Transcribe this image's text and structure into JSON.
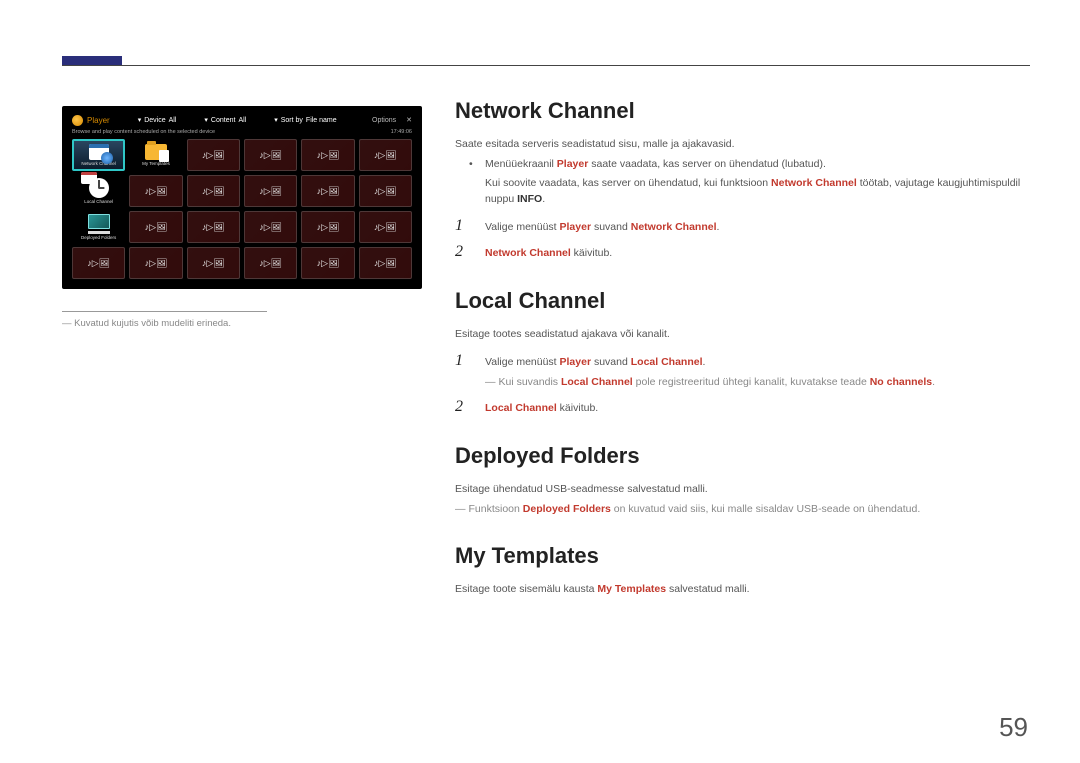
{
  "thumb": {
    "player_label": "Player",
    "device_label": "Device",
    "device_value": "All",
    "content_label": "Content",
    "content_value": "All",
    "sort_label": "Sort by",
    "sort_value": "File name",
    "options": "Options",
    "subtitle_left": "Browse and play content scheduled on the selected device",
    "subtitle_right": "17:49:06",
    "cells": {
      "network_channel": "Network Channel",
      "my_templates": "My Templates",
      "local_channel": "Local Channel",
      "deployed_folders": "Deployed Folders"
    }
  },
  "caption": "Kuvatud kujutis võib mudeliti erineda.",
  "sections": {
    "network": {
      "heading": "Network Channel",
      "desc": "Saate esitada serveris seadistatud sisu, malle ja ajakavasid.",
      "b1_pre": "Menüüekraanil ",
      "b1_player": "Player",
      "b1_post": " saate vaadata, kas server on ühendatud (lubatud).",
      "b2_pre": "Kui soovite vaadata, kas server on ühendatud, kui funktsioon ",
      "b2_nc": "Network Channel",
      "b2_mid": " töötab, vajutage kaugjuhtimispuldil nuppu ",
      "b2_info": "INFO",
      "s1_pre": "Valige menüüst ",
      "s1_player": "Player",
      "s1_mid": " suvand ",
      "s1_nc": "Network Channel",
      "s2_nc": "Network Channel",
      "s2_post": " käivitub."
    },
    "local": {
      "heading": "Local Channel",
      "desc": "Esitage tootes seadistatud ajakava või kanalit.",
      "s1_pre": "Valige menüüst ",
      "s1_player": "Player",
      "s1_mid": " suvand ",
      "s1_lc": "Local Channel",
      "note_pre": "Kui suvandis ",
      "note_lc": "Local Channel",
      "note_mid": " pole registreeritud ühtegi kanalit, kuvatakse teade ",
      "note_nc": "No channels",
      "s2_lc": "Local Channel",
      "s2_post": " käivitub."
    },
    "deployed": {
      "heading": "Deployed Folders",
      "desc": "Esitage ühendatud USB-seadmesse salvestatud malli.",
      "note_pre": "Funktsioon ",
      "note_df": "Deployed Folders",
      "note_post": " on kuvatud vaid siis, kui malle sisaldav USB-seade on ühendatud."
    },
    "templates": {
      "heading": "My Templates",
      "desc_pre": "Esitage toote sisemälu kausta ",
      "desc_mt": "My Templates",
      "desc_post": " salvestatud malli."
    }
  },
  "page_number": "59"
}
